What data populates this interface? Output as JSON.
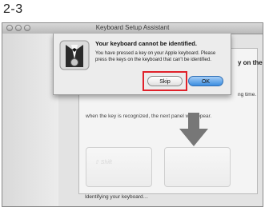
{
  "step_label": "2-3",
  "window": {
    "title": "Keyboard Setup Assistant"
  },
  "panel": {
    "heading_tail": "y on the",
    "text_tail": "ng time.",
    "text_line": "when the key is recognized, the next panel will appear."
  },
  "keys": {
    "shift_label": "⇧ Shift"
  },
  "status": "Identifying your keyboard…",
  "alert": {
    "title": "Your keyboard cannot be identified.",
    "message": "You have pressed a key on your Apple keyboard. Please press the keys on the keyboard that can't be identified.",
    "skip_label": "Skip",
    "ok_label": "OK"
  },
  "colors": {
    "highlight": "#e0212a",
    "default_button": "#3b8de0"
  },
  "icons": {
    "alert_icon": "keyboard-assistant-icon",
    "arrow": "arrow-down-icon"
  }
}
